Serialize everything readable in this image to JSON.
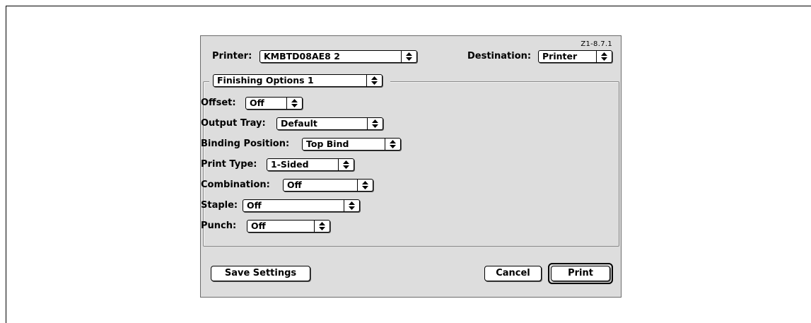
{
  "dialog": {
    "version": "Z1-8.7.1",
    "printer_label": "Printer:",
    "printer_value": "KMBTD08AE8 2",
    "destination_label": "Destination:",
    "destination_value": "Printer",
    "panel_value": "Finishing Options 1"
  },
  "options": {
    "offset": {
      "label": "Offset:",
      "value": "Off"
    },
    "output_tray": {
      "label": "Output Tray:",
      "value": "Default"
    },
    "binding_position": {
      "label": "Binding Position:",
      "value": "Top Bind"
    },
    "print_type": {
      "label": "Print Type:",
      "value": "1-Sided"
    },
    "combination": {
      "label": "Combination:",
      "value": "Off"
    },
    "staple": {
      "label": "Staple:",
      "value": "Off"
    },
    "punch": {
      "label": "Punch:",
      "value": "Off"
    }
  },
  "buttons": {
    "save_settings": "Save Settings",
    "cancel": "Cancel",
    "print": "Print"
  },
  "icons": {
    "popup_arrows": "up-down-arrows-icon"
  }
}
